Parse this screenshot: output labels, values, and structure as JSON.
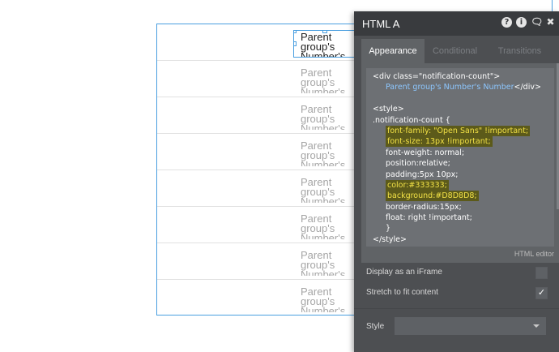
{
  "editor": {
    "cell_text": "Parent group's Number's"
  },
  "panel": {
    "title": "HTML A",
    "header_icons": [
      "help-icon",
      "info-icon",
      "comment-icon",
      "close-icon"
    ],
    "tabs": [
      {
        "label": "Appearance",
        "active": true
      },
      {
        "label": "Conditional",
        "active": false
      },
      {
        "label": "Transitions",
        "active": false
      }
    ],
    "code_lines": {
      "l1": "<div class=\"notification-count\">",
      "l2": "Parent group's Number's Number",
      "l2_tail": "</div>",
      "l3": "<style>",
      "l4": ".notification-count {",
      "l5": "font-family: \"Open Sans\" !important;",
      "l6": "font-size: 13px !important;",
      "l7": "font-weight: normal;",
      "l8": "position:relative;",
      "l9": "padding:5px 10px;",
      "l10": "color:#333333;",
      "l11": "background:#D8D8D8;",
      "l12": "border-radius:15px;",
      "l13": "float: right !important;",
      "l14": "}",
      "l15": "</style>"
    },
    "editor_label": "HTML editor",
    "options": {
      "iframe_label": "Display as an iFrame",
      "iframe_checked": false,
      "stretch_label": "Stretch to fit content",
      "stretch_checked": true
    },
    "style_label": "Style",
    "style_value": ""
  }
}
